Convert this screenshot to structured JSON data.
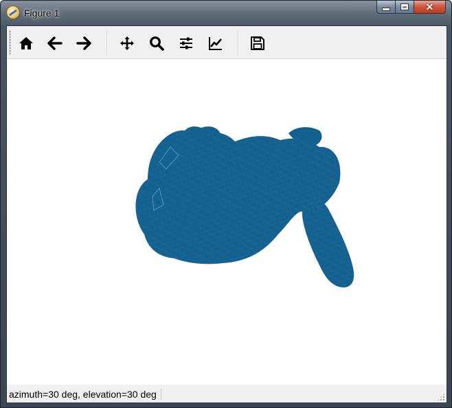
{
  "window": {
    "title": "Figure 1",
    "app_icon": "matplotlib-icon"
  },
  "caption_buttons": {
    "minimize_icon": "minimize-icon",
    "maximize_icon": "maximize-icon",
    "close_icon": "close-icon"
  },
  "toolbar": {
    "buttons": [
      {
        "name": "home",
        "icon": "home-icon"
      },
      {
        "name": "back",
        "icon": "arrow-left-icon"
      },
      {
        "name": "forward",
        "icon": "arrow-right-icon"
      },
      {
        "name": "pan",
        "icon": "move-icon"
      },
      {
        "name": "zoom",
        "icon": "magnifier-icon"
      },
      {
        "name": "configure-subplots",
        "icon": "sliders-icon"
      },
      {
        "name": "edit-axis",
        "icon": "line-chart-icon"
      },
      {
        "name": "save",
        "icon": "floppy-disk-icon"
      }
    ]
  },
  "plot": {
    "description_color": "#14618f",
    "mesh_color": "#14618f"
  },
  "status": {
    "text": "azimuth=30 deg, elevation=30 deg"
  }
}
